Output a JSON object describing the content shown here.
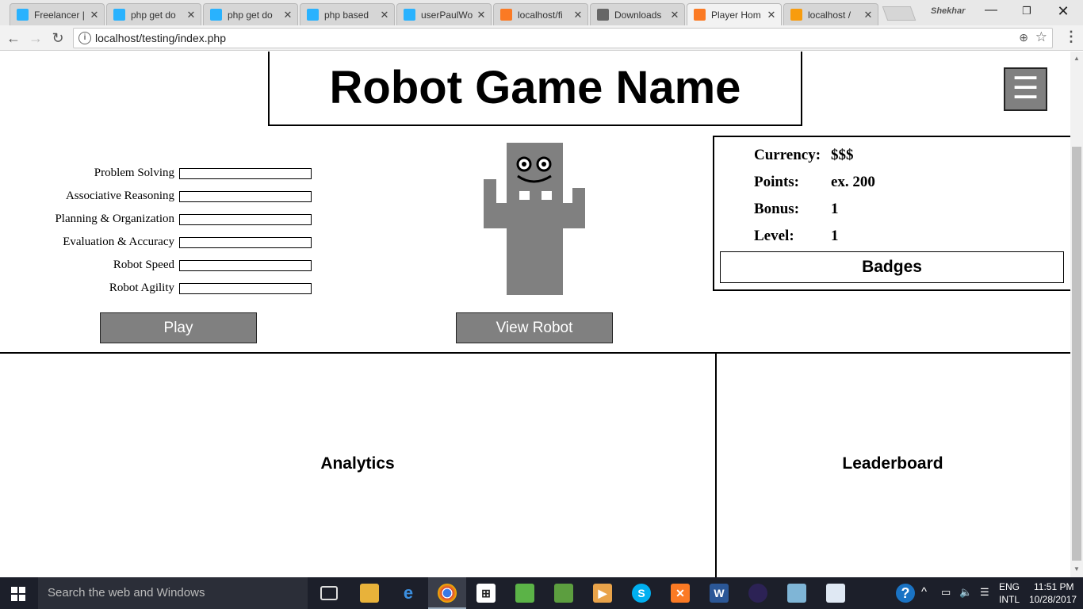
{
  "browser": {
    "tabs": [
      {
        "title": "Freelancer |",
        "favicon": "freelancer-icon",
        "color": "#29b2fe",
        "active": false
      },
      {
        "title": "php get do",
        "favicon": "freelancer-icon",
        "color": "#29b2fe",
        "active": false
      },
      {
        "title": "php get do",
        "favicon": "freelancer-icon",
        "color": "#29b2fe",
        "active": false
      },
      {
        "title": "php based",
        "favicon": "freelancer-icon",
        "color": "#29b2fe",
        "active": false
      },
      {
        "title": "userPaulWo",
        "favicon": "freelancer-icon",
        "color": "#29b2fe",
        "active": false
      },
      {
        "title": "localhost/fi",
        "favicon": "xampp-icon",
        "color": "#fb7a24",
        "active": false
      },
      {
        "title": "Downloads",
        "favicon": "download-icon",
        "color": "#666666",
        "active": false
      },
      {
        "title": "Player Hom",
        "favicon": "xampp-icon",
        "color": "#fb7a24",
        "active": true
      },
      {
        "title": "localhost /",
        "favicon": "phpmyadmin-icon",
        "color": "#f89c0e",
        "active": false
      }
    ],
    "user_name": "Shekhar",
    "url": "localhost/testing/index.php"
  },
  "page": {
    "title": "Robot Game Name",
    "menu_icon": "☰",
    "stats": [
      {
        "label": "Problem Solving",
        "level": 0
      },
      {
        "label": "Associative Reasoning",
        "level": 0
      },
      {
        "label": "Planning & Organization",
        "level": 0
      },
      {
        "label": "Evaluation & Accuracy",
        "level": 0
      },
      {
        "label": "Robot Speed",
        "level": 0
      },
      {
        "label": "Robot Agility",
        "level": 0
      }
    ],
    "play_label": "Play",
    "view_robot_label": "View Robot",
    "info": {
      "currency_label": "Currency:",
      "currency_value": "$$$",
      "points_label": "Points:",
      "points_value": "ex. 200",
      "bonus_label": "Bonus:",
      "bonus_value": "1",
      "level_label": "Level:",
      "level_value": "1"
    },
    "badges_label": "Badges",
    "analytics_label": "Analytics",
    "leaderboard_label": "Leaderboard",
    "accent_gray": "#808080"
  },
  "taskbar": {
    "search_placeholder": "Search the web and Windows",
    "language": "ENG",
    "layout": "INTL",
    "time": "11:51 PM",
    "date": "10/28/2017"
  }
}
